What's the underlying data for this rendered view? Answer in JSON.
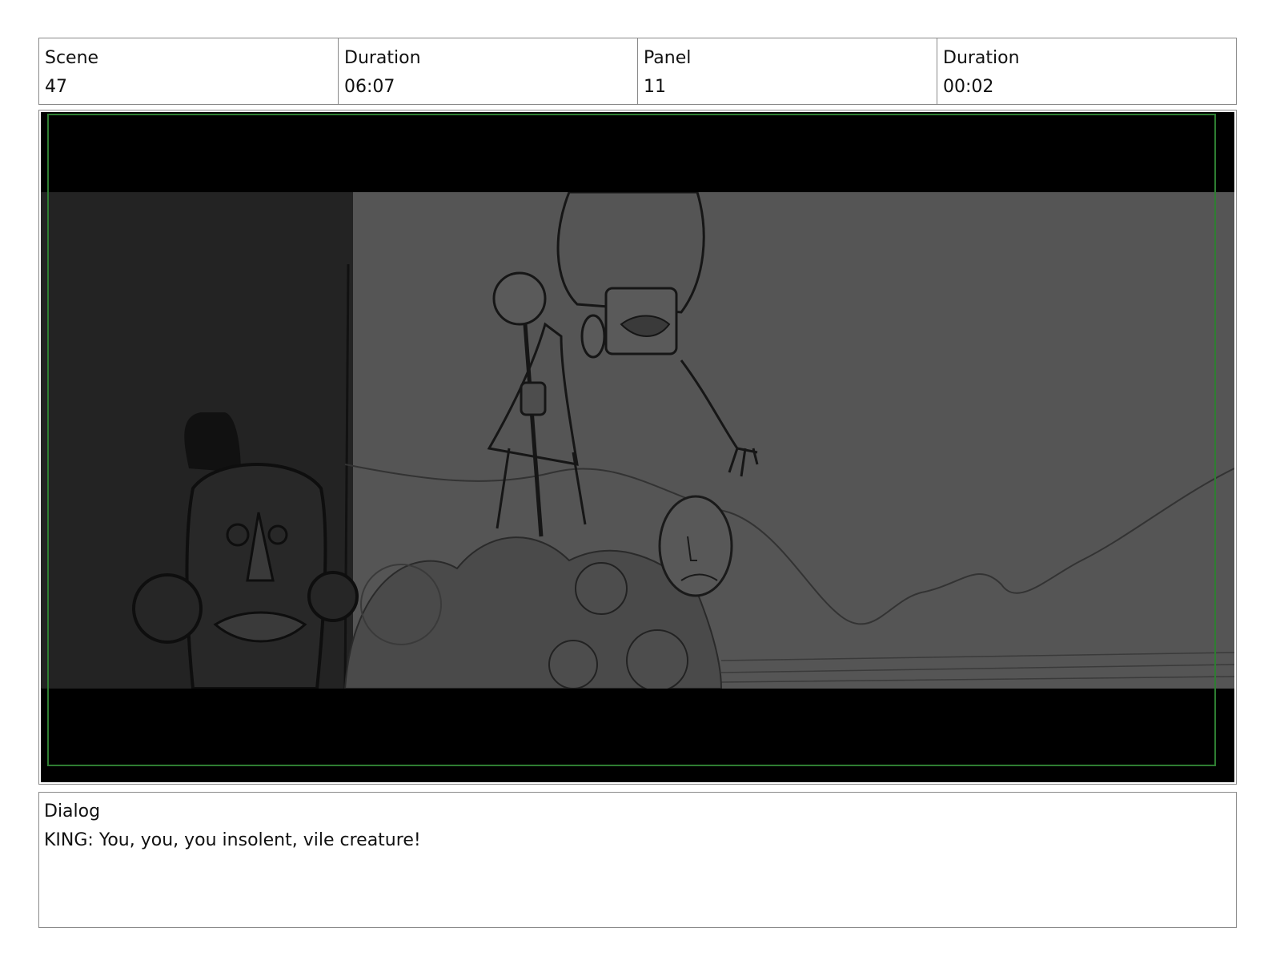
{
  "header": {
    "scene_label": "Scene",
    "scene_value": "47",
    "scene_duration_label": "Duration",
    "scene_duration_value": "06:07",
    "panel_label": "Panel",
    "panel_value": "11",
    "panel_duration_label": "Duration",
    "panel_duration_value": "00:02"
  },
  "colors": {
    "frame_border": "#2e7d32",
    "letterbox": "#000000",
    "background": "#555555"
  },
  "dialog": {
    "label": "Dialog",
    "text": "KING: You, you, you insolent, vile creature!"
  }
}
